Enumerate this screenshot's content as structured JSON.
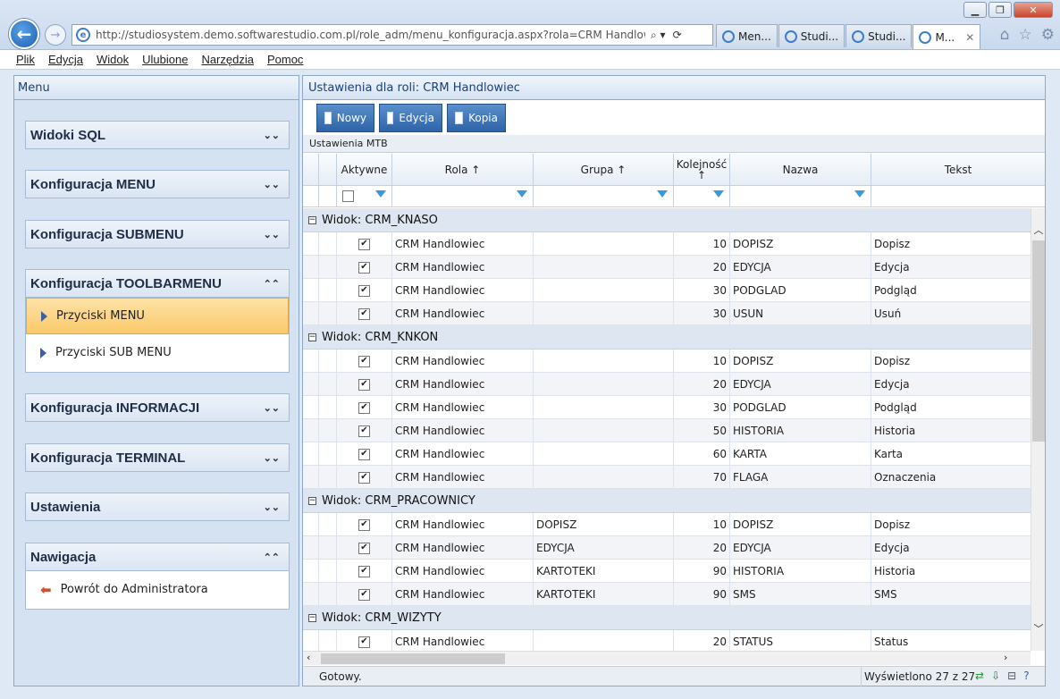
{
  "window": {
    "minimize": "▁",
    "restore": "❐",
    "close": "✕"
  },
  "address": {
    "url": "http://studiosystem.demo.softwarestudio.com.pl/role_adm/menu_konfiguracja.aspx?rola=CRM Handlowiec",
    "search_icon": "⌕ ▾",
    "tools": "⟳"
  },
  "tabs": [
    {
      "label": "Men..."
    },
    {
      "label": "Studi..."
    },
    {
      "label": "Studi..."
    },
    {
      "label": "M..."
    }
  ],
  "menubar": [
    "Plik",
    "Edycja",
    "Widok",
    "Ulubione",
    "Narzędzia",
    "Pomoc"
  ],
  "left": {
    "title": "Menu",
    "sections": [
      {
        "label": "Widoki SQL",
        "state": "collapsed"
      },
      {
        "label": "Konfiguracja MENU",
        "state": "collapsed"
      },
      {
        "label": "Konfiguracja SUBMENU",
        "state": "collapsed"
      },
      {
        "label": "Konfiguracja TOOLBARMENU",
        "state": "expanded"
      },
      {
        "label": "Konfiguracja INFORMACJI",
        "state": "collapsed"
      },
      {
        "label": "Konfiguracja TERMINAL",
        "state": "collapsed"
      },
      {
        "label": "Ustawienia",
        "state": "collapsed"
      },
      {
        "label": "Nawigacja",
        "state": "expanded"
      }
    ],
    "toolbar_items": [
      "Przyciski MENU",
      "Przyciski SUB MENU"
    ],
    "nav_items": [
      "Powrót do Administratora"
    ]
  },
  "right": {
    "title": "Ustawienia dla roli: CRM Handlowiec",
    "buttons": {
      "new": "Nowy",
      "edit": "Edycja",
      "copy": "Kopia"
    },
    "grid_caption": "Ustawienia MTB",
    "columns": {
      "aktywne": "Aktywne",
      "rola": "Rola ↑",
      "grupa": "Grupa ↑",
      "kolejnosc": "Kolejność ↑",
      "nazwa": "Nazwa",
      "tekst": "Tekst"
    },
    "groups": [
      {
        "label": "Widok: CRM_KNASO",
        "rows": [
          {
            "active": true,
            "rola": "CRM Handlowiec",
            "grupa": "",
            "kol": "10",
            "nazwa": "DOPISZ",
            "tekst": "Dopisz"
          },
          {
            "active": true,
            "rola": "CRM Handlowiec",
            "grupa": "",
            "kol": "20",
            "nazwa": "EDYCJA",
            "tekst": "Edycja"
          },
          {
            "active": true,
            "rola": "CRM Handlowiec",
            "grupa": "",
            "kol": "30",
            "nazwa": "PODGLAD",
            "tekst": "Podgląd"
          },
          {
            "active": true,
            "rola": "CRM Handlowiec",
            "grupa": "",
            "kol": "30",
            "nazwa": "USUN",
            "tekst": "Usuń"
          }
        ]
      },
      {
        "label": "Widok: CRM_KNKON",
        "rows": [
          {
            "active": true,
            "rola": "CRM Handlowiec",
            "grupa": "",
            "kol": "10",
            "nazwa": "DOPISZ",
            "tekst": "Dopisz"
          },
          {
            "active": true,
            "rola": "CRM Handlowiec",
            "grupa": "",
            "kol": "20",
            "nazwa": "EDYCJA",
            "tekst": "Edycja"
          },
          {
            "active": true,
            "rola": "CRM Handlowiec",
            "grupa": "",
            "kol": "30",
            "nazwa": "PODGLAD",
            "tekst": "Podgląd"
          },
          {
            "active": true,
            "rola": "CRM Handlowiec",
            "grupa": "",
            "kol": "50",
            "nazwa": "HISTORIA",
            "tekst": "Historia"
          },
          {
            "active": true,
            "rola": "CRM Handlowiec",
            "grupa": "",
            "kol": "60",
            "nazwa": "KARTA",
            "tekst": "Karta"
          },
          {
            "active": true,
            "rola": "CRM Handlowiec",
            "grupa": "",
            "kol": "70",
            "nazwa": "FLAGA",
            "tekst": "Oznaczenia"
          }
        ]
      },
      {
        "label": "Widok: CRM_PRACOWNICY",
        "rows": [
          {
            "active": true,
            "rola": "CRM Handlowiec",
            "grupa": "DOPISZ",
            "kol": "10",
            "nazwa": "DOPISZ",
            "tekst": "Dopisz"
          },
          {
            "active": true,
            "rola": "CRM Handlowiec",
            "grupa": "EDYCJA",
            "kol": "20",
            "nazwa": "EDYCJA",
            "tekst": "Edycja"
          },
          {
            "active": true,
            "rola": "CRM Handlowiec",
            "grupa": "KARTOTEKI",
            "kol": "90",
            "nazwa": "HISTORIA",
            "tekst": "Historia"
          },
          {
            "active": true,
            "rola": "CRM Handlowiec",
            "grupa": "KARTOTEKI",
            "kol": "90",
            "nazwa": "SMS",
            "tekst": "SMS"
          }
        ]
      },
      {
        "label": "Widok: CRM_WIZYTY",
        "rows": [
          {
            "active": true,
            "rola": "CRM Handlowiec",
            "grupa": "",
            "kol": "20",
            "nazwa": "STATUS",
            "tekst": "Status"
          }
        ]
      }
    ],
    "status": {
      "message": "Gotowy.",
      "count": "Wyświetlono 27 z 27"
    }
  }
}
